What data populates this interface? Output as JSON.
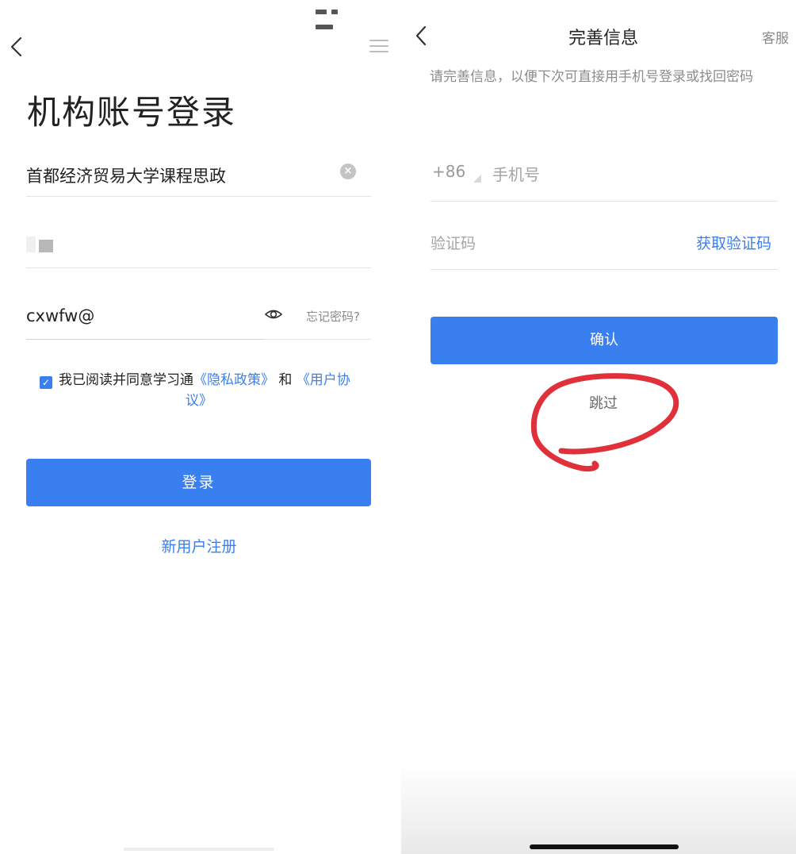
{
  "login": {
    "title": "机构账号登录",
    "org_value": "首都经济贸易大学课程思政",
    "password_value": "cxwfw@",
    "forgot_label": "忘记密码?",
    "agree_prefix": "我已阅读并同意学习通",
    "privacy_link": "《隐私政策》",
    "agree_and": "和",
    "user_agreement_link_part1": "《用户协",
    "user_agreement_link_part2": "议》",
    "login_button": "登录",
    "register_link": "新用户注册"
  },
  "complete_info": {
    "title": "完善信息",
    "service_link": "客服",
    "hint": "请完善信息，以便下次可直接用手机号登录或找回密码",
    "country_code": "+86",
    "phone_placeholder": "手机号",
    "code_placeholder": "验证码",
    "get_code_label": "获取验证码",
    "confirm_button": "确认",
    "skip_link": "跳过"
  },
  "colors": {
    "accent": "#3a7ff0",
    "annotation": "#e0313b"
  },
  "icons": [
    "back-chevron-icon",
    "menu-icon",
    "clear-icon",
    "eye-icon",
    "checkbox-checked-icon",
    "dropdown-triangle-icon"
  ]
}
